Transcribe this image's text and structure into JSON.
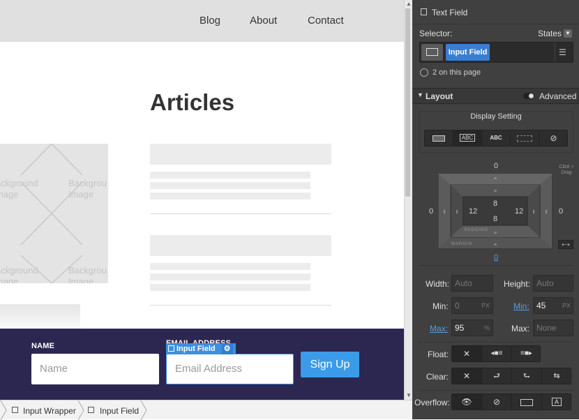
{
  "nav": {
    "blog": "Blog",
    "about": "About",
    "contact": "Contact"
  },
  "main": {
    "heading": "Articles",
    "image_placeholder": {
      "tl": "ackground\nmage",
      "tr": "Backgrou\nImage",
      "bl": "ackground\nmage",
      "br": "Backgrou\nImage"
    }
  },
  "form": {
    "name_label": "NAME",
    "name_placeholder": "Name",
    "email_label": "EMAIL ADDRESS",
    "email_placeholder": "Email Address",
    "submit": "Sign Up",
    "selection_badge": "Input Field"
  },
  "breadcrumbs": [
    "Input Wrapper",
    "Input Field"
  ],
  "panel": {
    "element_type": "Text Field",
    "selector_label": "Selector:",
    "states_label": "States",
    "selector_chip": "Input Field",
    "count_text": "2 on this page",
    "layout_title": "Layout",
    "advanced_label": "Advanced",
    "display_setting": "Display Setting",
    "display_abc1": "ABC",
    "display_abc2": "ABC",
    "box": {
      "margin_top": "0",
      "margin_left": "0",
      "margin_right": "0",
      "margin_bottom": "0",
      "padding_top": "8",
      "padding_left": "12",
      "padding_right": "12",
      "padding_bottom": "8",
      "padding_caption": "PADDING",
      "margin_caption": "MARGIN",
      "hint": "Click + Drag"
    },
    "sizes": {
      "width_label": "Width:",
      "width_value": "Auto",
      "height_label": "Height:",
      "height_value": "Auto",
      "min_label": "Min:",
      "min_w": "0",
      "min_w_unit": "PX",
      "min_label2": "Min:",
      "min_h": "45",
      "min_h_unit": "PX",
      "max_label": "Max:",
      "max_w": "95",
      "max_w_unit": "%",
      "max_label2": "Max:",
      "max_h": "None"
    },
    "float_label": "Float:",
    "clear_label": "Clear:",
    "overflow_label": "Overflow:"
  },
  "colors": {
    "accent": "#3c9be8",
    "footer": "#2c2751",
    "panel": "#404040"
  }
}
